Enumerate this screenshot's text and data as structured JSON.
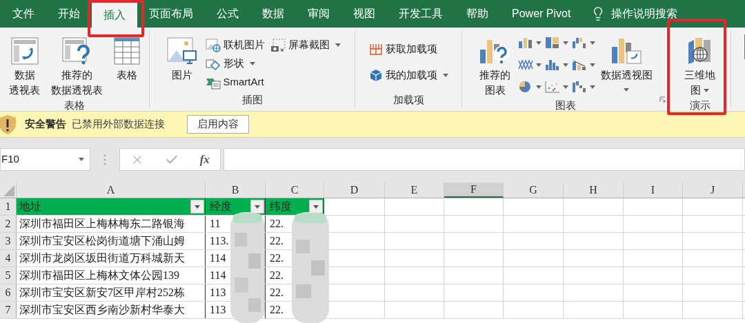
{
  "tabs": [
    {
      "label": "文件",
      "selected": false
    },
    {
      "label": "开始",
      "selected": false
    },
    {
      "label": "插入",
      "selected": true
    },
    {
      "label": "页面布局",
      "selected": false
    },
    {
      "label": "公式",
      "selected": false
    },
    {
      "label": "数据",
      "selected": false
    },
    {
      "label": "审阅",
      "selected": false
    },
    {
      "label": "视图",
      "selected": false
    },
    {
      "label": "开发工具",
      "selected": false
    },
    {
      "label": "帮助",
      "selected": false
    },
    {
      "label": "Power Pivot",
      "selected": false
    }
  ],
  "tell_me": "操作说明搜索",
  "ribbon": {
    "groups": [
      {
        "title": "表格",
        "launcher": false,
        "items": [
          {
            "kind": "large",
            "lines": [
              "数据",
              "透视表"
            ],
            "dropdown": false
          },
          {
            "kind": "large",
            "lines": [
              "推荐的",
              "数据透视表"
            ],
            "dropdown": false
          },
          {
            "kind": "large",
            "lines": [
              "表格"
            ],
            "dropdown": false
          }
        ]
      },
      {
        "title": "插图",
        "launcher": false,
        "items": [
          {
            "kind": "large",
            "lines": [
              "图片"
            ],
            "dropdown": false
          },
          {
            "kind": "small",
            "label": "联机图片",
            "dropdown": false
          },
          {
            "kind": "small",
            "label": "形状",
            "dropdown": true
          },
          {
            "kind": "small",
            "label": "SmartArt",
            "dropdown": false
          },
          {
            "kind": "small",
            "label": "屏幕截图",
            "dropdown": true
          }
        ]
      },
      {
        "title": "加载项",
        "launcher": false,
        "items": [
          {
            "kind": "small",
            "label": "获取加载项",
            "dropdown": false
          },
          {
            "kind": "small",
            "label": "我的加载项",
            "dropdown": true
          }
        ]
      },
      {
        "title": "图表",
        "launcher": true,
        "items": [
          {
            "kind": "large",
            "lines": [
              "推荐的",
              "图表"
            ],
            "dropdown": false
          },
          {
            "kind": "chart-gallery"
          },
          {
            "kind": "large",
            "lines": [
              "数据透视图"
            ],
            "dropdown": true
          }
        ]
      },
      {
        "title": "演示",
        "launcher": false,
        "items": [
          {
            "kind": "large",
            "lines": [
              "三维地",
              "图"
            ],
            "dropdown": true
          }
        ]
      }
    ]
  },
  "security_bar": {
    "title": "安全警告",
    "message": "已禁用外部数据连接",
    "button": "启用内容"
  },
  "formula_bar": {
    "name_box": "F10",
    "function_symbol": "fx"
  },
  "sheet": {
    "columns": [
      {
        "label": "A",
        "selected": false
      },
      {
        "label": "B",
        "selected": false
      },
      {
        "label": "C",
        "selected": false
      },
      {
        "label": "D",
        "selected": false
      },
      {
        "label": "E",
        "selected": false
      },
      {
        "label": "F",
        "selected": true
      },
      {
        "label": "G",
        "selected": false
      },
      {
        "label": "H",
        "selected": false
      },
      {
        "label": "I",
        "selected": false
      },
      {
        "label": "J",
        "selected": false
      }
    ],
    "rows": [
      {
        "number": "1",
        "kind": "header",
        "cells": [
          "地址",
          "经度",
          "纬度"
        ]
      },
      {
        "number": "2",
        "kind": "data",
        "cells": [
          "深圳市福田区上梅林梅东二路银海",
          "11",
          "22."
        ]
      },
      {
        "number": "3",
        "kind": "data",
        "cells": [
          "深圳市宝安区松岗街道塘下涌山姆",
          "113.",
          "22."
        ]
      },
      {
        "number": "4",
        "kind": "data",
        "cells": [
          "深圳市龙岗区坂田街道万科城新天",
          "114",
          "22."
        ]
      },
      {
        "number": "5",
        "kind": "data",
        "cells": [
          "深圳市福田区上梅林文体公园139",
          "114",
          "22."
        ]
      },
      {
        "number": "6",
        "kind": "data",
        "cells": [
          "深圳市宝安区新安7区甲岸村252栋",
          "113",
          "22."
        ]
      },
      {
        "number": "7",
        "kind": "data",
        "cells": [
          "深圳市宝安区西乡南沙新村华泰大",
          "113",
          "22."
        ]
      }
    ]
  }
}
